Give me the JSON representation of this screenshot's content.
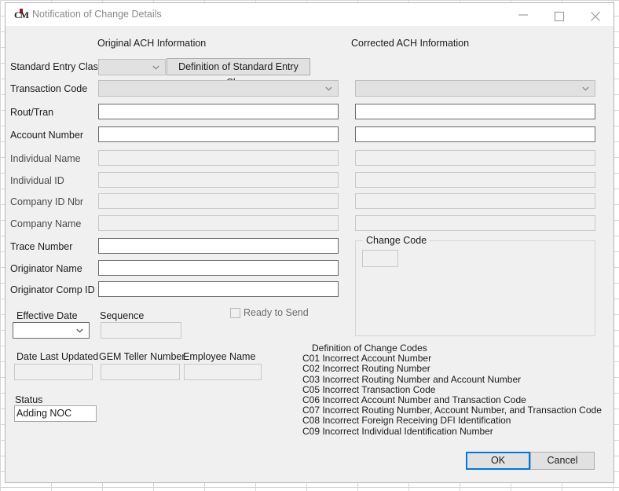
{
  "window": {
    "title": "Notification of Change Details",
    "icon": "app-logo-icon",
    "minimize_label": "minimize-icon",
    "maximize_label": "maximize-icon",
    "close_label": "close-icon"
  },
  "headers": {
    "original": "Original ACH Information",
    "corrected": "Corrected ACH Information"
  },
  "fields": {
    "standard_entry_class": {
      "label": "Standard Entry Class",
      "value": "",
      "enabled": false
    },
    "definition_button": {
      "label": "Definition of Standard Entry Class"
    },
    "transaction_code": {
      "label": "Transaction Code",
      "original_value": "",
      "corrected_value": "",
      "enabled": false
    },
    "rout_tran": {
      "label": "Rout/Tran",
      "original_value": "",
      "corrected_value": "",
      "enabled": true
    },
    "account_number": {
      "label": "Account Number",
      "original_value": "",
      "corrected_value": "",
      "enabled": true
    },
    "individual_name": {
      "label": "Individual Name",
      "original_value": "",
      "corrected_value": "",
      "enabled": false
    },
    "individual_id": {
      "label": "Individual ID",
      "original_value": "",
      "corrected_value": "",
      "enabled": false
    },
    "company_id_nbr": {
      "label": "Company ID Nbr",
      "original_value": "",
      "corrected_value": "",
      "enabled": false
    },
    "company_name": {
      "label": "Company Name",
      "original_value": "",
      "corrected_value": "",
      "enabled": false
    },
    "trace_number": {
      "label": "Trace Number",
      "value": "",
      "enabled": true
    },
    "originator_name": {
      "label": "Originator Name",
      "value": "",
      "enabled": true
    },
    "originator_comp_id": {
      "label": "Originator Comp ID",
      "value": "",
      "enabled": true
    },
    "effective_date": {
      "label": "Effective Date",
      "value": "",
      "enabled": true
    },
    "sequence": {
      "label": "Sequence",
      "value": "",
      "enabled": false
    },
    "date_last_updated": {
      "label": "Date Last Updated",
      "value": "",
      "enabled": false
    },
    "gem_teller_number": {
      "label": "GEM Teller Number",
      "value": "",
      "enabled": false
    },
    "employee_name": {
      "label": "Employee Name",
      "value": "",
      "enabled": false
    },
    "status": {
      "label": "Status",
      "value": "Adding NOC"
    }
  },
  "ready_to_send": {
    "label": "Ready to Send",
    "checked": false,
    "enabled": false
  },
  "change_code_group": {
    "legend": "Change Code",
    "value": ""
  },
  "change_code_definitions": {
    "heading": "Definition of Change Codes",
    "items": [
      "C01 Incorrect Account Number",
      "C02 Incorrect Routing Number",
      "C03 Incorrect Routing Number and Account Number",
      "C05 Incorrect Transaction Code",
      "C06 Incorrect Account Number and Transaction Code",
      "C07 Incorrect Routing Number, Account Number, and Transaction Code",
      "C08 Incorrect Foreign Receiving DFI Identification",
      "C09 Incorrect Individual Identification Number"
    ]
  },
  "buttons": {
    "ok": "OK",
    "cancel": "Cancel"
  },
  "colors": {
    "dialog_background": "#f0f0f0",
    "focus_accent": "#0078d7",
    "field_border": "#6b6b6b",
    "disabled_field": "#f0f0f0"
  }
}
